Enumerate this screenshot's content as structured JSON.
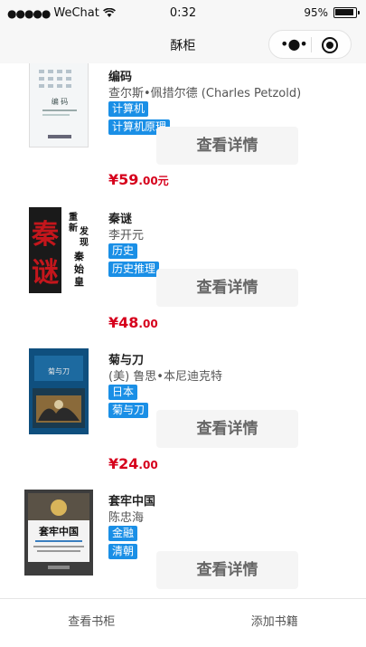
{
  "status_bar": {
    "carrier": "WeChat",
    "time": "0:32",
    "battery": "95%"
  },
  "nav": {
    "title": "酥柜"
  },
  "books": [
    {
      "title": "编码",
      "author": "查尔斯•佩措尔德 (Charles Petzold)",
      "tags": [
        "计算机",
        "计算机原理"
      ],
      "detail_label": "查看详情",
      "price_main": "¥59",
      "price_cents": ".00元",
      "cover_text": "编 码"
    },
    {
      "title": "秦谜",
      "author": "李开元",
      "tags": [
        "历史",
        "历史推理"
      ],
      "detail_label": "查看详情",
      "price_main": "¥48",
      "price_cents": ".00",
      "cover_text": "秦谜"
    },
    {
      "title": "菊与刀",
      "author": "(美) 鲁思•本尼迪克特",
      "tags": [
        "日本",
        "菊与刀"
      ],
      "detail_label": "查看详情",
      "price_main": "¥24",
      "price_cents": ".00",
      "cover_text": "菊与刀"
    },
    {
      "title": "套牢中国",
      "author": "陈忠海",
      "tags": [
        "金融",
        "清朝"
      ],
      "detail_label": "查看详情",
      "price_main": "",
      "price_cents": "",
      "cover_text": "套牢中国"
    }
  ],
  "tabbar": {
    "items": [
      "查看书柜",
      "添加书籍"
    ]
  }
}
